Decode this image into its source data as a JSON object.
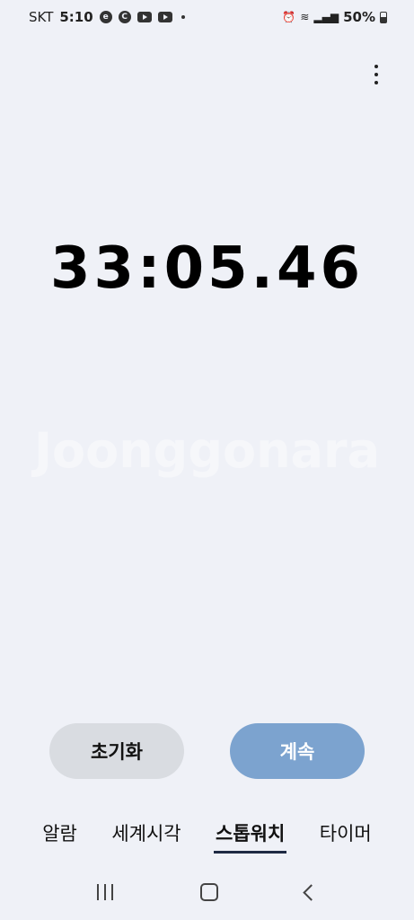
{
  "status": {
    "carrier": "SKT",
    "time": "5:10",
    "icons": [
      "c-circle-icon",
      "c-circle-icon",
      "youtube-icon",
      "youtube-icon",
      "notification-dot-icon",
      "alarm-clock-icon",
      "wifi-icon",
      "signal-icon",
      "battery-icon"
    ],
    "battery": "50%"
  },
  "stopwatch": {
    "time": "33:05.46"
  },
  "watermark": "Joonggonara",
  "buttons": {
    "reset": "초기화",
    "resume": "계속"
  },
  "tabs": [
    {
      "label": "알람"
    },
    {
      "label": "세계시각"
    },
    {
      "label": "스톱워치",
      "active": true
    },
    {
      "label": "타이머"
    }
  ],
  "colors": {
    "background": "#eff1f7",
    "reset_button": "#d9dce1",
    "resume_button": "#7ca3cf",
    "active_tab_indicator": "#1e2a44"
  }
}
